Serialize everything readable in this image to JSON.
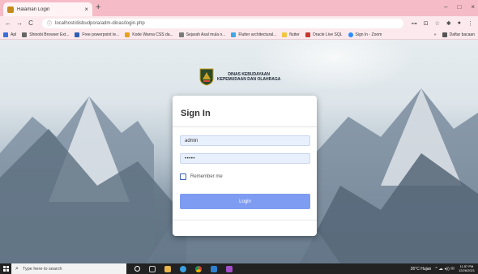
{
  "browser": {
    "tab_title": "Halaman Login",
    "tab_close": "×",
    "new_tab": "+",
    "window_controls": [
      "–",
      "□",
      "×"
    ],
    "nav": {
      "back": "←",
      "forward": "→",
      "reload": "C"
    },
    "address": {
      "icon": "ⓘ",
      "url": "localhost/disbudpora/adm-dinas/login.php"
    },
    "toolbar_icons": [
      "key-icon",
      "share-icon",
      "star-icon",
      "extension-icon",
      "profile-icon",
      "menu-icon"
    ],
    "toolbar_glyphs": [
      "⊶",
      "⊡",
      "☆",
      "✱",
      "●",
      "⋮"
    ]
  },
  "bookmarks": {
    "items": [
      {
        "label": "Apl",
        "color": "#3b6fd6"
      },
      {
        "label": "Shinobi Browser Ext...",
        "color": "#666666"
      },
      {
        "label": "Free powerpoint te...",
        "color": "#2f5fb5"
      },
      {
        "label": "Kode Warna CSS da...",
        "color": "#e6a21b"
      },
      {
        "label": "Sejarah Asal mula o...",
        "color": "#7a7a7a"
      },
      {
        "label": "Flutter architectural...",
        "color": "#41a7e8"
      },
      {
        "label": "flutter",
        "color": "#f1c640"
      },
      {
        "label": "Oracle Live SQL",
        "color": "#c8382d"
      },
      {
        "label": "Sign In - Zoom",
        "color": "#2d8cff"
      }
    ],
    "more": "»",
    "reading_list": "Daftar bacaan"
  },
  "page": {
    "brand": {
      "line1": "DINAS KEBUDAYAAN",
      "line2": "KEPEMUDAAN DAN OLAHRAGA"
    },
    "login": {
      "title": "Sign In",
      "username_value": "admin",
      "password_value": "•••••",
      "remember_label": "Remember me",
      "button_label": "Login"
    }
  },
  "taskbar": {
    "search_placeholder": "Type here to search",
    "weather": "26°C  Hujan",
    "tray_glyphs": "^  ☁  ◂))  ✉",
    "time": "11:57 PM",
    "date": "12/26/2021"
  },
  "colors": {
    "tabstrip": "#f5bcc7",
    "login_button": "#7e9cf2",
    "field_bg": "#e8f0fe",
    "taskbar": "#222222"
  }
}
